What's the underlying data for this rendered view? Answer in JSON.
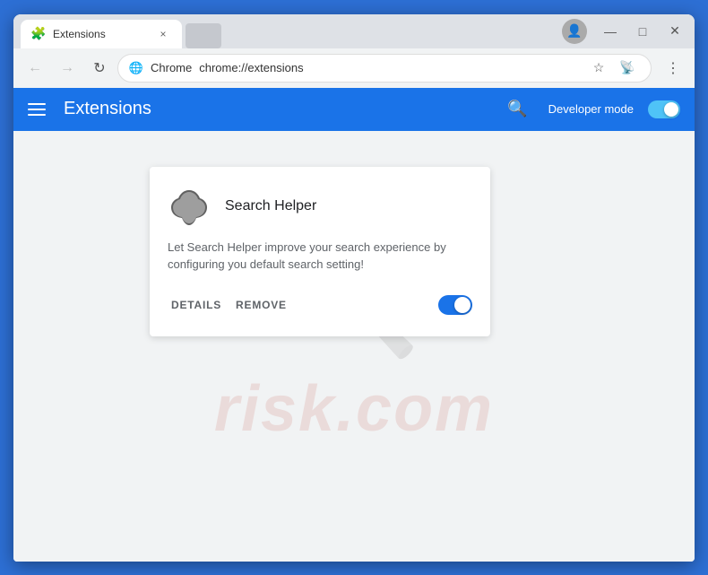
{
  "browser": {
    "title": "Extensions",
    "tab_favicon": "🧩",
    "tab_close": "×",
    "address_security_icon": "🔵",
    "chrome_label": "Chrome",
    "address_url": "chrome://extensions",
    "profile_icon": "👤",
    "nav": {
      "back": "←",
      "forward": "→",
      "refresh": "↻"
    },
    "window_controls": {
      "minimize": "—",
      "maximize": "□",
      "close": "✕"
    }
  },
  "extensions_page": {
    "header_title": "Extensions",
    "search_icon": "🔍",
    "developer_mode_label": "Developer mode",
    "toggle_state": "on"
  },
  "extension_card": {
    "name": "Search Helper",
    "description": "Let Search Helper improve your search experience by configuring you default search setting!",
    "details_button": "DETAILS",
    "remove_button": "REMOVE",
    "toggle_state": "on"
  },
  "watermark": {
    "text": "risk.com"
  }
}
